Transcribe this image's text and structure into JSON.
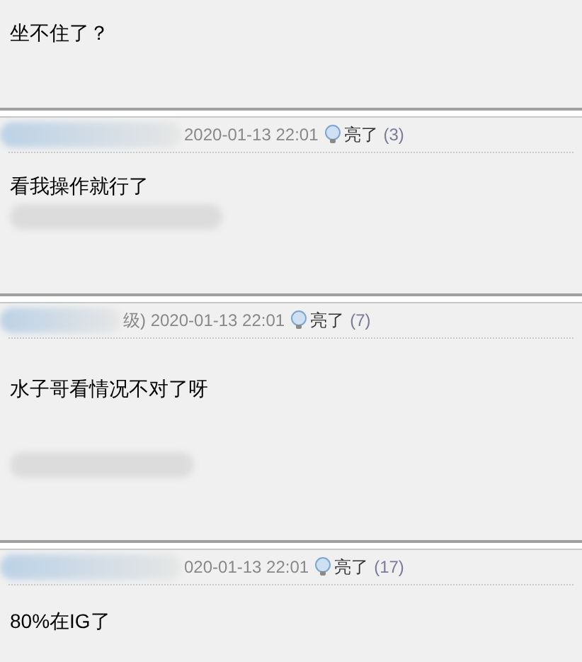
{
  "posts": [
    {
      "body": "坐不住了？",
      "blurred_signature": false
    },
    {
      "meta": "2020-01-13 22:01",
      "likes_label": "亮了",
      "likes_count": "(3)",
      "body": "看我操作就行了",
      "blurred_signature": true
    },
    {
      "meta": "级) 2020-01-13 22:01",
      "likes_label": "亮了",
      "likes_count": "(7)",
      "body": "水子哥看情况不对了呀",
      "blurred_signature": true
    },
    {
      "meta": "020-01-13 22:01",
      "likes_label": "亮了",
      "likes_count": "(17)",
      "body": "80%在IG了",
      "blurred_signature": false
    }
  ]
}
